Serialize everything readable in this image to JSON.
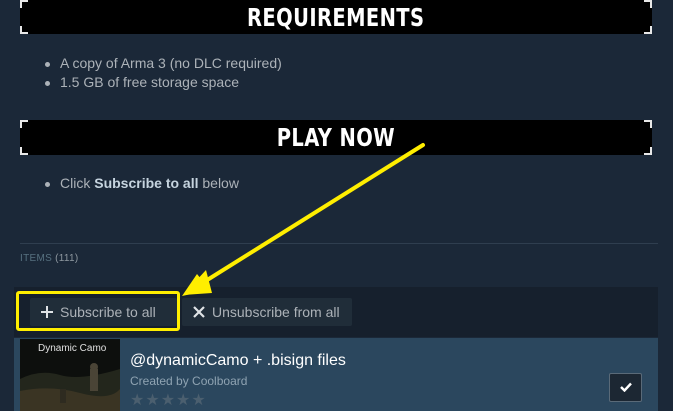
{
  "sections": {
    "requirements_title": "REQUIREMENTS",
    "requirements_items": [
      "A copy of Arma 3 (no DLC required)",
      "1.5 GB of free storage space"
    ],
    "play_title": "PLAY NOW",
    "play_prefix": "Click ",
    "play_bold": "Subscribe to all",
    "play_suffix": " below"
  },
  "items_header": {
    "label": "ITEMS",
    "count": "(111)"
  },
  "toolbar": {
    "subscribe_all": "Subscribe to all",
    "unsubscribe_all": "Unsubscribe from all"
  },
  "item": {
    "thumb_caption": "Dynamic Camo",
    "title": "@dynamicCamo + .bisign files",
    "author_prefix": "Created by ",
    "author": "Coolboard",
    "stars": "★★★★★"
  },
  "colors": {
    "background": "#1b2838",
    "highlight": "#ffee00",
    "item_row": "#2b475e"
  }
}
